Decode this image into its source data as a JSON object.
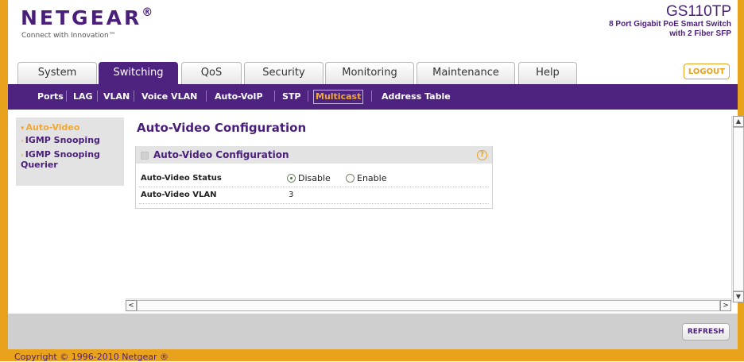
{
  "header": {
    "logo": "NETGEAR",
    "logo_mark": "®",
    "tagline": "Connect with Innovation™",
    "model": "GS110TP",
    "model_desc_1": "8 Port Gigabit PoE Smart Switch",
    "model_desc_2": "with 2 Fiber SFP"
  },
  "tabs": [
    {
      "label": "System"
    },
    {
      "label": "Switching"
    },
    {
      "label": "QoS"
    },
    {
      "label": "Security"
    },
    {
      "label": "Monitoring"
    },
    {
      "label": "Maintenance"
    },
    {
      "label": "Help"
    }
  ],
  "active_tab": "Switching",
  "logout_label": "LOGOUT",
  "subnav": [
    {
      "label": "Ports"
    },
    {
      "label": "LAG"
    },
    {
      "label": "VLAN"
    },
    {
      "label": "Voice VLAN"
    },
    {
      "label": "Auto-VoIP"
    },
    {
      "label": "STP"
    },
    {
      "label": "Multicast"
    },
    {
      "label": "Address Table"
    }
  ],
  "active_subnav": "Multicast",
  "leftnav": [
    {
      "label": "Auto-Video"
    },
    {
      "label": "IGMP Snooping"
    },
    {
      "label": "IGMP Snooping"
    },
    {
      "label": "Querier"
    }
  ],
  "page": {
    "title": "Auto-Video Configuration",
    "panel_title": "Auto-Video Configuration",
    "help_glyph": "?",
    "status_label": "Auto-Video Status",
    "status_options": [
      "Disable",
      "Enable"
    ],
    "status_selected": "Disable",
    "vlan_label": "Auto-Video VLAN",
    "vlan_value": "3"
  },
  "scroll": {
    "up": "▲",
    "down": "▼",
    "left": "<",
    "right": ">"
  },
  "refresh_label": "REFRESH",
  "copyright": "Copyright © 1996-2010 Netgear ®",
  "colors": {
    "brand_purple": "#4d237f",
    "accent_orange": "#e8a21c"
  }
}
